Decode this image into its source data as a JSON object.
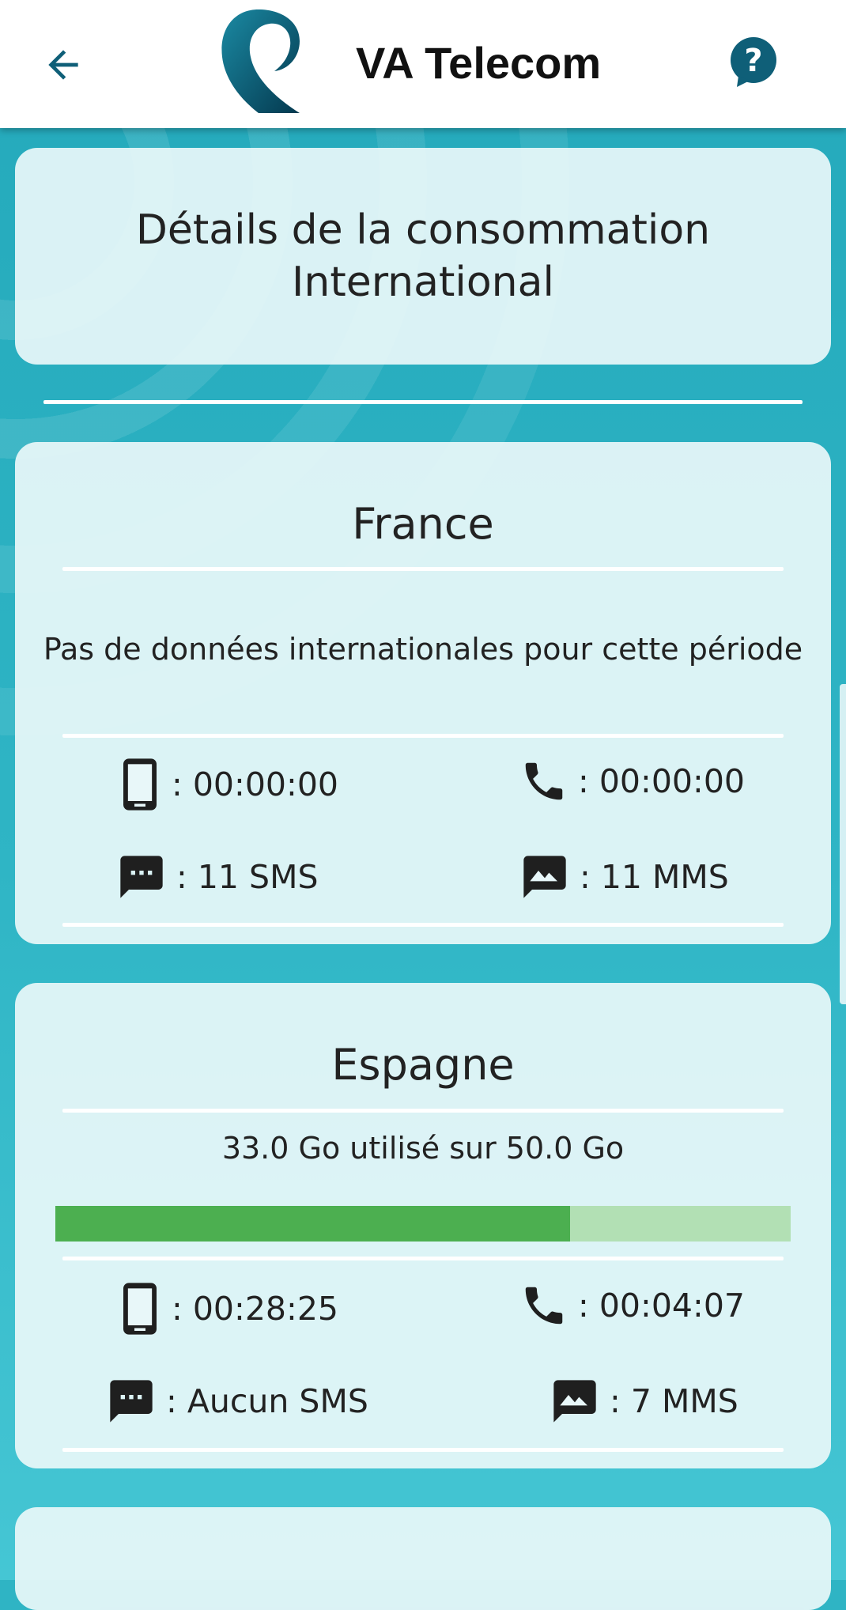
{
  "app": {
    "title": "VA Telecom",
    "accent_color": "#0f5f78",
    "icons": {
      "back": "arrow-left-icon",
      "help": "help-circle-icon",
      "logo": "va-telecom-logo"
    }
  },
  "header": {
    "line1": "Détails de la consommation",
    "line2": "International"
  },
  "countries": [
    {
      "name": "France",
      "message": "Pas de données internationales pour cette période",
      "mobile_time": ": 00:00:00",
      "call_time": ": 00:00:00",
      "sms": ": 11 SMS",
      "mms": ": 11 MMS"
    },
    {
      "name": "Espagne",
      "usage_text": "33.0 Go utilisé sur 50.0 Go",
      "usage_fraction": 0.7,
      "progress_fill_color": "#4caf50",
      "progress_track_color": "#b2e0b4",
      "mobile_time": ": 00:28:25",
      "call_time": ": 00:04:07",
      "sms": ": Aucun SMS",
      "mms": ": 7 MMS"
    }
  ]
}
